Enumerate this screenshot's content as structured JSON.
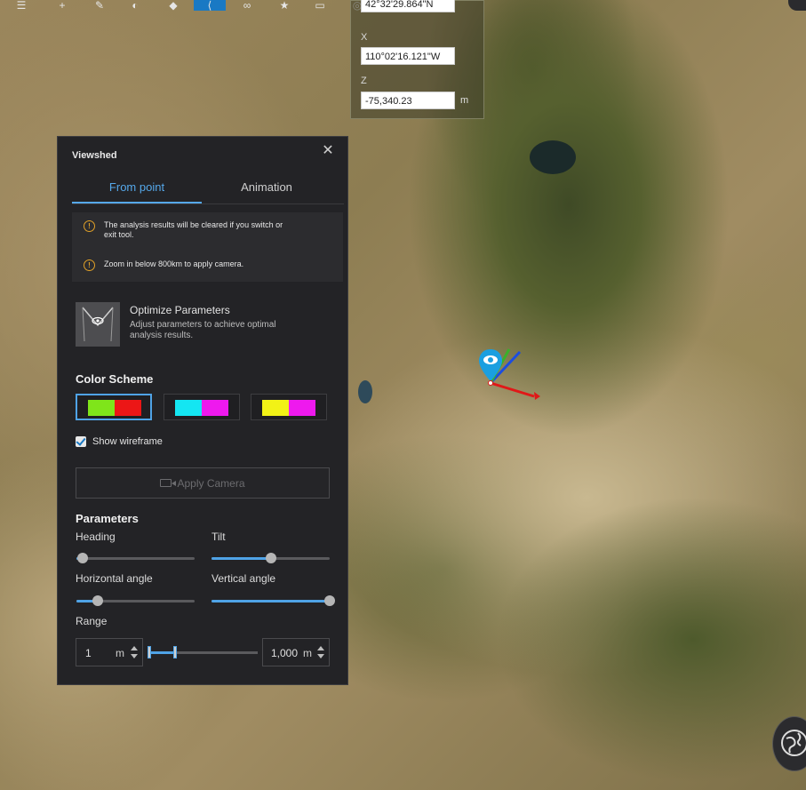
{
  "toolbar": {
    "buttons": [
      {
        "name": "list-icon",
        "glyph": "☰"
      },
      {
        "name": "plus-icon",
        "glyph": "+"
      },
      {
        "name": "draw-icon",
        "glyph": "✎"
      },
      {
        "name": "shape-icon",
        "glyph": "◐"
      },
      {
        "name": "place-icon",
        "glyph": "◆"
      },
      {
        "name": "viewshed-icon",
        "glyph": "⟨",
        "active": true
      },
      {
        "name": "interlock-icon",
        "glyph": "∞"
      },
      {
        "name": "bookmark-icon",
        "glyph": "★"
      },
      {
        "name": "window-icon",
        "glyph": "▭"
      },
      {
        "name": "view-icon",
        "glyph": "◎"
      },
      {
        "name": "grid-icon",
        "glyph": "▦"
      }
    ]
  },
  "coordinates": {
    "y_value": "42°32'29.864\"N",
    "x_label": "X",
    "x_value": "110°02'16.121\"W",
    "z_label": "Z",
    "z_value": "-75,340.23",
    "z_unit": "m"
  },
  "panel": {
    "title": "Viewshed",
    "tabs": [
      "From point",
      "Animation"
    ],
    "notices": [
      "The analysis results will be cleared if you switch or exit tool.",
      "Zoom in below 800km to apply camera."
    ],
    "optimize": {
      "title": "Optimize Parameters",
      "description": "Adjust parameters to achieve optimal analysis results."
    },
    "color_scheme": {
      "title": "Color Scheme",
      "options": [
        {
          "colors": [
            "#7fe51a",
            "#ec1616"
          ],
          "selected": true
        },
        {
          "colors": [
            "#14e6f2",
            "#ee19ee"
          ],
          "selected": false
        },
        {
          "colors": [
            "#f2f216",
            "#ee19ee"
          ],
          "selected": false
        }
      ]
    },
    "show_wireframe": {
      "label": "Show wireframe",
      "checked": true
    },
    "apply_camera": "Apply Camera",
    "parameters": {
      "title": "Parameters",
      "heading": {
        "label": "Heading",
        "value": 0.05
      },
      "tilt": {
        "label": "Tilt",
        "value": 0.5
      },
      "horizontal_angle": {
        "label": "Horizontal angle",
        "value": 0.18
      },
      "vertical_angle": {
        "label": "Vertical angle",
        "value": 1.0
      }
    },
    "range": {
      "label": "Range",
      "min_value": "1",
      "min_unit": "m",
      "max_value": "1,000",
      "max_unit": "m",
      "fraction": 0.23
    }
  }
}
